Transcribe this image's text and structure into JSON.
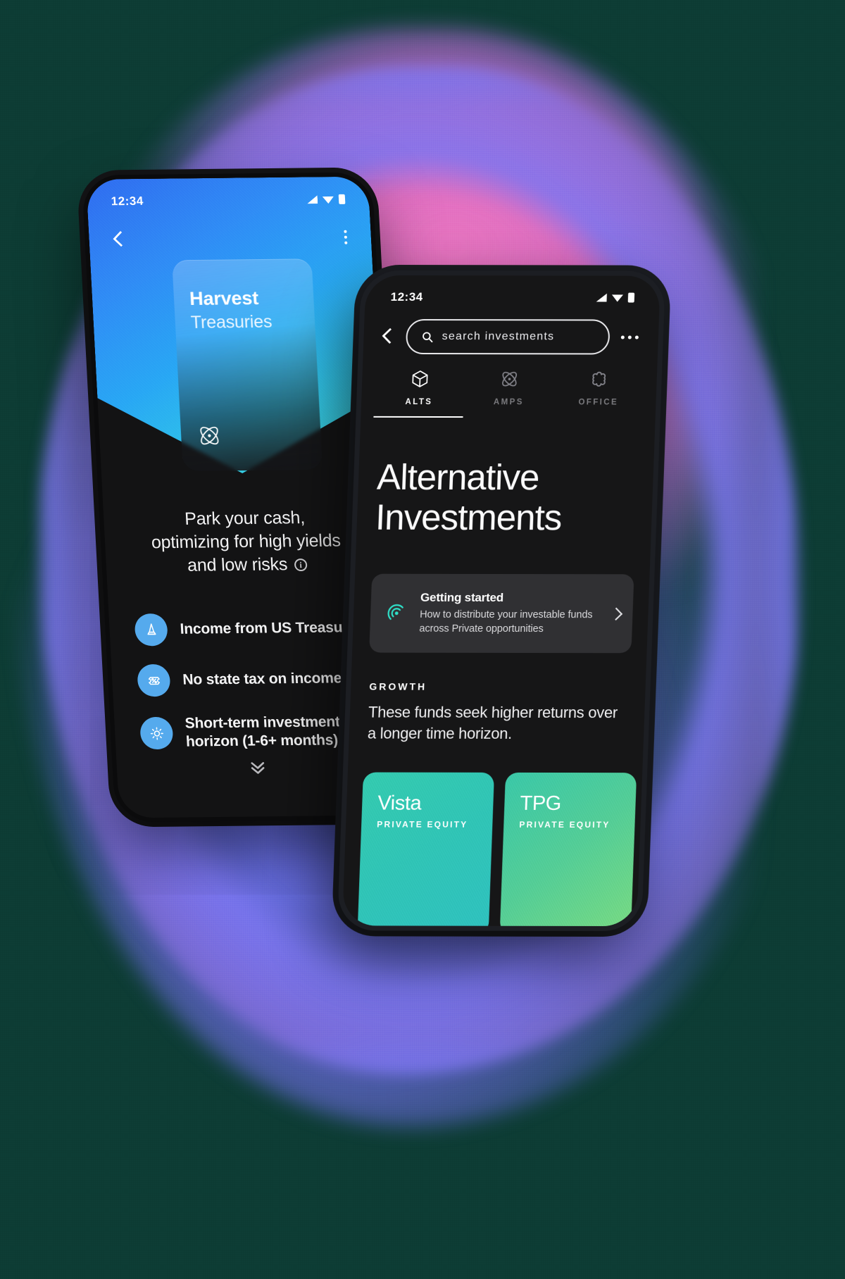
{
  "background": {
    "canvas_color": "#0d3c34",
    "brush_pink": "#e275c1",
    "brush_blue": "#6070ee",
    "brush_violet": "#9a6eeb"
  },
  "left_phone": {
    "status_bar": {
      "time": "12:34",
      "icons": [
        "signal-icon",
        "wifi-icon",
        "battery-icon"
      ]
    },
    "nav": {
      "back_icon": "chevron-left-icon",
      "overflow_icon": "kebab-menu-icon"
    },
    "hero_card": {
      "title": "Harvest",
      "subtitle": "Treasuries",
      "icon": "atom-icon",
      "gradient_from": "#2f6bf0",
      "gradient_to": "#3fd6d2"
    },
    "lead_text_lines": [
      "Park your cash,",
      "optimizing for high yields",
      "and low risks"
    ],
    "lead_info_icon": "info-circle-icon",
    "features": [
      {
        "icon": "monument-icon",
        "label": "Income from US Treasuries"
      },
      {
        "icon": "tax-ticket-icon",
        "label": "No state tax on income"
      },
      {
        "icon": "sun-icon",
        "label": "Short-term investment\nhorizon (1-6+ months)"
      }
    ],
    "features_flat": [
      "Income from US Treasuries",
      "No state tax on income",
      "Short-term investment",
      "horizon (1-6+ months)"
    ],
    "more_icon": "double-chevron-down-icon",
    "accent_color": "#55aaed"
  },
  "right_phone": {
    "status_bar": {
      "time": "12:34",
      "icons": [
        "signal-icon",
        "wifi-icon",
        "battery-icon"
      ]
    },
    "header": {
      "back_icon": "chevron-left-icon",
      "overflow_icon": "more-horizontal-icon"
    },
    "search": {
      "placeholder": "search investments",
      "icon": "search-icon"
    },
    "tabs": [
      {
        "label": "ALTS",
        "icon": "cube-icon",
        "active": true
      },
      {
        "label": "AMPS",
        "icon": "atom-icon",
        "active": false
      },
      {
        "label": "OFFICE",
        "icon": "flower-icon",
        "active": false
      }
    ],
    "page_title_lines": [
      "Alternative",
      "Investments"
    ],
    "getting_started": {
      "icon": "broadcast-icon",
      "icon_color": "#2fe0c8",
      "heading": "Getting started",
      "body": "How to distribute your investable funds across Private opportunities",
      "chevron_icon": "chevron-right-icon"
    },
    "section": {
      "label": "GROWTH",
      "description": "These funds seek higher returns over a longer time horizon."
    },
    "funds": [
      {
        "name": "Vista",
        "type": "PRIVATE EQUITY",
        "color_from": "#2fc3ae",
        "color_to": "#35c4bd"
      },
      {
        "name": "TPG",
        "type": "PRIVATE EQUITY",
        "color_from": "#3fc6a8",
        "color_to": "#6fd689"
      },
      {
        "name": "",
        "type": "",
        "color_from": "#35c9a6",
        "color_to": "#4fd09a"
      }
    ]
  }
}
